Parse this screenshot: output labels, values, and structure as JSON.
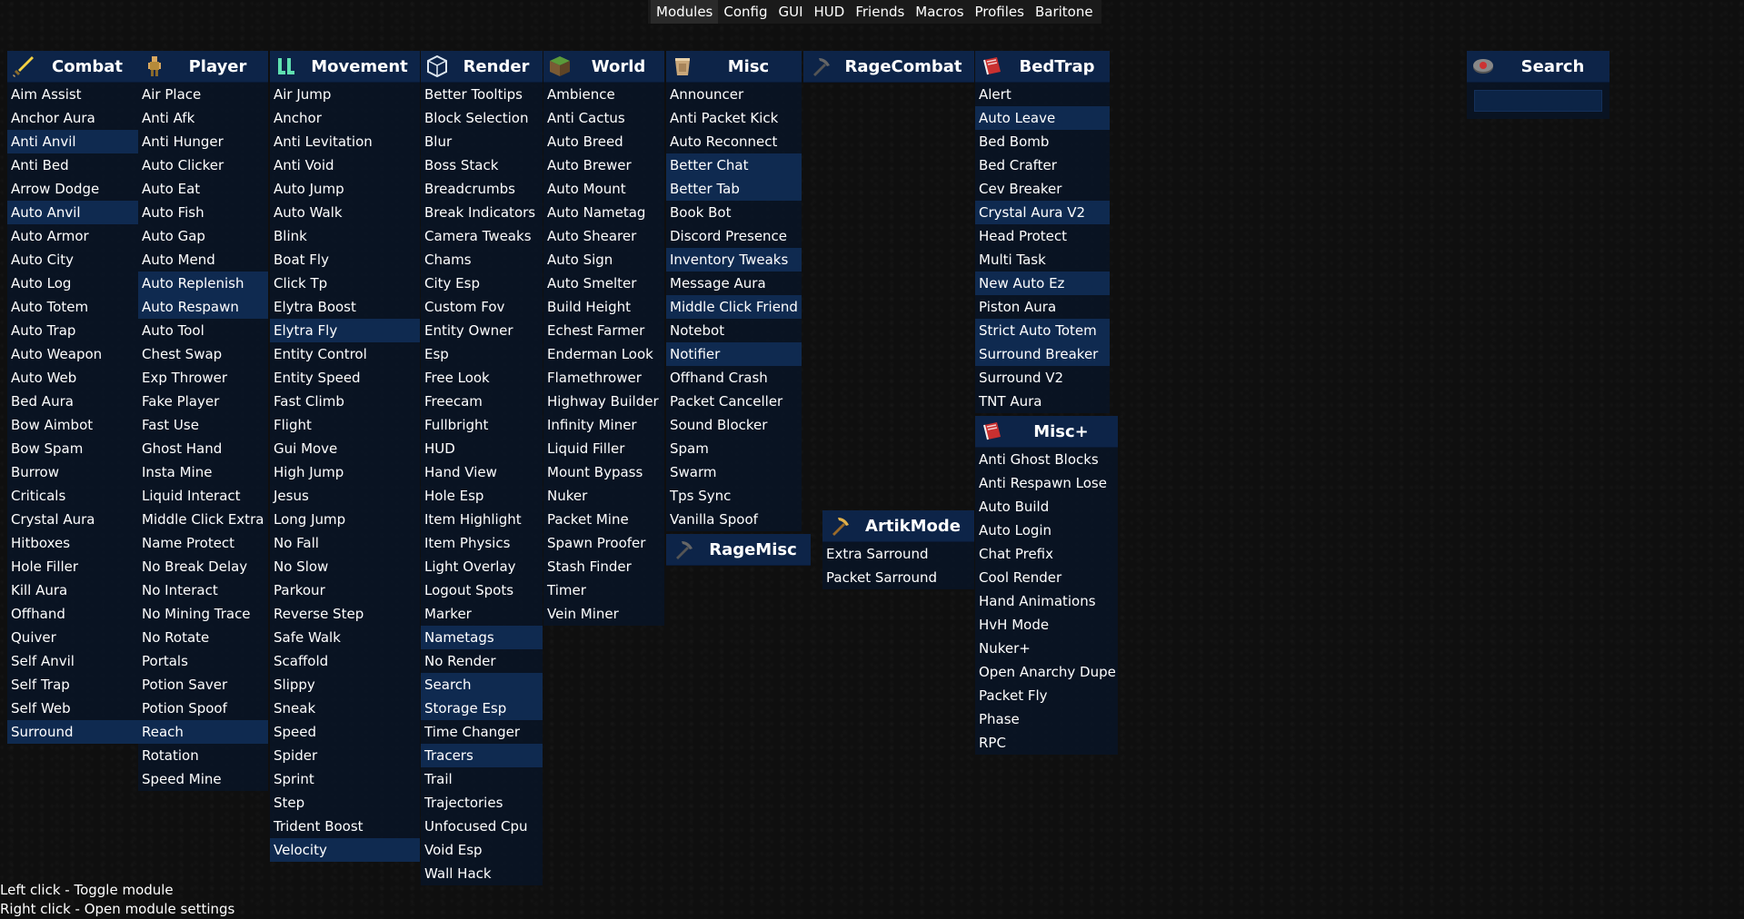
{
  "topbar": {
    "tabs": [
      "Modules",
      "Config",
      "GUI",
      "HUD",
      "Friends",
      "Macros",
      "Profiles",
      "Baritone"
    ],
    "active": "Modules"
  },
  "panels": [
    {
      "title": "Combat",
      "icon": "sword-icon",
      "enabled": [
        "Anti Anvil",
        "Auto Anvil",
        "Surround"
      ],
      "modules": [
        "Aim Assist",
        "Anchor Aura",
        "Anti Anvil",
        "Anti Bed",
        "Arrow Dodge",
        "Auto Anvil",
        "Auto Armor",
        "Auto City",
        "Auto Log",
        "Auto Totem",
        "Auto Trap",
        "Auto Weapon",
        "Auto Web",
        "Bed Aura",
        "Bow Aimbot",
        "Bow Spam",
        "Burrow",
        "Criticals",
        "Crystal Aura",
        "Hitboxes",
        "Hole Filler",
        "Kill Aura",
        "Offhand",
        "Quiver",
        "Self Anvil",
        "Self Trap",
        "Self Web",
        "Surround"
      ]
    },
    {
      "title": "Player",
      "icon": "player-icon",
      "enabled": [
        "Auto Replenish",
        "Auto Respawn",
        "Reach"
      ],
      "modules": [
        "Air Place",
        "Anti Afk",
        "Anti Hunger",
        "Auto Clicker",
        "Auto Eat",
        "Auto Fish",
        "Auto Gap",
        "Auto Mend",
        "Auto Replenish",
        "Auto Respawn",
        "Auto Tool",
        "Chest Swap",
        "Exp Thrower",
        "Fake Player",
        "Fast Use",
        "Ghost Hand",
        "Insta Mine",
        "Liquid Interact",
        "Middle Click Extra",
        "Name Protect",
        "No Break Delay",
        "No Interact",
        "No Mining Trace",
        "No Rotate",
        "Portals",
        "Potion Saver",
        "Potion Spoof",
        "Reach",
        "Rotation",
        "Speed Mine"
      ]
    },
    {
      "title": "Movement",
      "icon": "boots-icon",
      "enabled": [
        "Elytra Fly",
        "Velocity"
      ],
      "modules": [
        "Air Jump",
        "Anchor",
        "Anti Levitation",
        "Anti Void",
        "Auto Jump",
        "Auto Walk",
        "Blink",
        "Boat Fly",
        "Click Tp",
        "Elytra Boost",
        "Elytra Fly",
        "Entity Control",
        "Entity Speed",
        "Fast Climb",
        "Flight",
        "Gui Move",
        "High Jump",
        "Jesus",
        "Long Jump",
        "No Fall",
        "No Slow",
        "Parkour",
        "Reverse Step",
        "Safe Walk",
        "Scaffold",
        "Slippy",
        "Sneak",
        "Speed",
        "Spider",
        "Sprint",
        "Step",
        "Trident Boost",
        "Velocity"
      ]
    },
    {
      "title": "Render",
      "icon": "glass-cube-icon",
      "enabled": [
        "Nametags",
        "Search",
        "Storage Esp",
        "Tracers"
      ],
      "modules": [
        "Better Tooltips",
        "Block Selection",
        "Blur",
        "Boss Stack",
        "Breadcrumbs",
        "Break Indicators",
        "Camera Tweaks",
        "Chams",
        "City Esp",
        "Custom Fov",
        "Entity Owner",
        "Esp",
        "Free Look",
        "Freecam",
        "Fullbright",
        "HUD",
        "Hand View",
        "Hole Esp",
        "Item Highlight",
        "Item Physics",
        "Light Overlay",
        "Logout Spots",
        "Marker",
        "Nametags",
        "No Render",
        "Search",
        "Storage Esp",
        "Time Changer",
        "Tracers",
        "Trail",
        "Trajectories",
        "Unfocused Cpu",
        "Void Esp",
        "Wall Hack"
      ]
    },
    {
      "title": "World",
      "icon": "grass-block-icon",
      "enabled": [],
      "modules": [
        "Ambience",
        "Anti Cactus",
        "Auto Breed",
        "Auto Brewer",
        "Auto Mount",
        "Auto Nametag",
        "Auto Shearer",
        "Auto Sign",
        "Auto Smelter",
        "Build Height",
        "Echest Farmer",
        "Enderman Look",
        "Flamethrower",
        "Highway Builder",
        "Infinity Miner",
        "Liquid Filler",
        "Mount Bypass",
        "Nuker",
        "Packet Mine",
        "Spawn Proofer",
        "Stash Finder",
        "Timer",
        "Vein Miner"
      ]
    },
    {
      "title": "Misc",
      "icon": "bucket-icon",
      "enabled": [
        "Better Chat",
        "Better Tab",
        "Inventory Tweaks",
        "Middle Click Friend",
        "Notifier"
      ],
      "modules": [
        "Announcer",
        "Anti Packet Kick",
        "Auto Reconnect",
        "Better Chat",
        "Better Tab",
        "Book Bot",
        "Discord Presence",
        "Inventory Tweaks",
        "Message Aura",
        "Middle Click Friend",
        "Notebot",
        "Notifier",
        "Offhand Crash",
        "Packet Canceller",
        "Sound Blocker",
        "Spam",
        "Swarm",
        "Tps Sync",
        "Vanilla Spoof"
      ]
    },
    {
      "title": "RageMisc",
      "icon": "dark-pickaxe-icon",
      "enabled": [],
      "modules": []
    },
    {
      "title": "RageCombat",
      "icon": "dark-pickaxe-icon",
      "enabled": [],
      "modules": []
    },
    {
      "title": "ArtikMode",
      "icon": "pickaxe-icon",
      "enabled": [],
      "modules": [
        "Extra Sarround",
        "Packet Sarround"
      ]
    },
    {
      "title": "BedTrap",
      "icon": "red-book-icon",
      "enabled": [
        "Auto Leave",
        "Crystal Aura V2",
        "New Auto Ez",
        "Strict Auto Totem",
        "Surround Breaker"
      ],
      "modules": [
        "Alert",
        "Auto Leave",
        "Bed Bomb",
        "Bed Crafter",
        "Cev Breaker",
        "Crystal Aura V2",
        "Head Protect",
        "Multi Task",
        "New Auto Ez",
        "Piston Aura",
        "Strict Auto Totem",
        "Surround Breaker",
        "Surround V2",
        "TNT Aura"
      ]
    },
    {
      "title": "Misc+",
      "icon": "red-book-icon",
      "enabled": [],
      "modules": [
        "Anti Ghost Blocks",
        "Anti Respawn Lose",
        "Auto Build",
        "Auto Login",
        "Chat Prefix",
        "Cool Render",
        "Hand Animations",
        "HvH Mode",
        "Nuker+",
        "Open Anarchy Dupe",
        "Packet Fly",
        "Phase",
        "RPC"
      ]
    },
    {
      "title": "Search",
      "icon": "search-icon",
      "enabled": [],
      "modules": []
    }
  ],
  "search": {
    "value": "",
    "placeholder": ""
  },
  "help": {
    "line1": "Left click - Toggle module",
    "line2": "Right click - Open module settings"
  },
  "colors": {
    "header": "#0d2448",
    "body": "#08142890",
    "enabled": "#0f2a50"
  }
}
